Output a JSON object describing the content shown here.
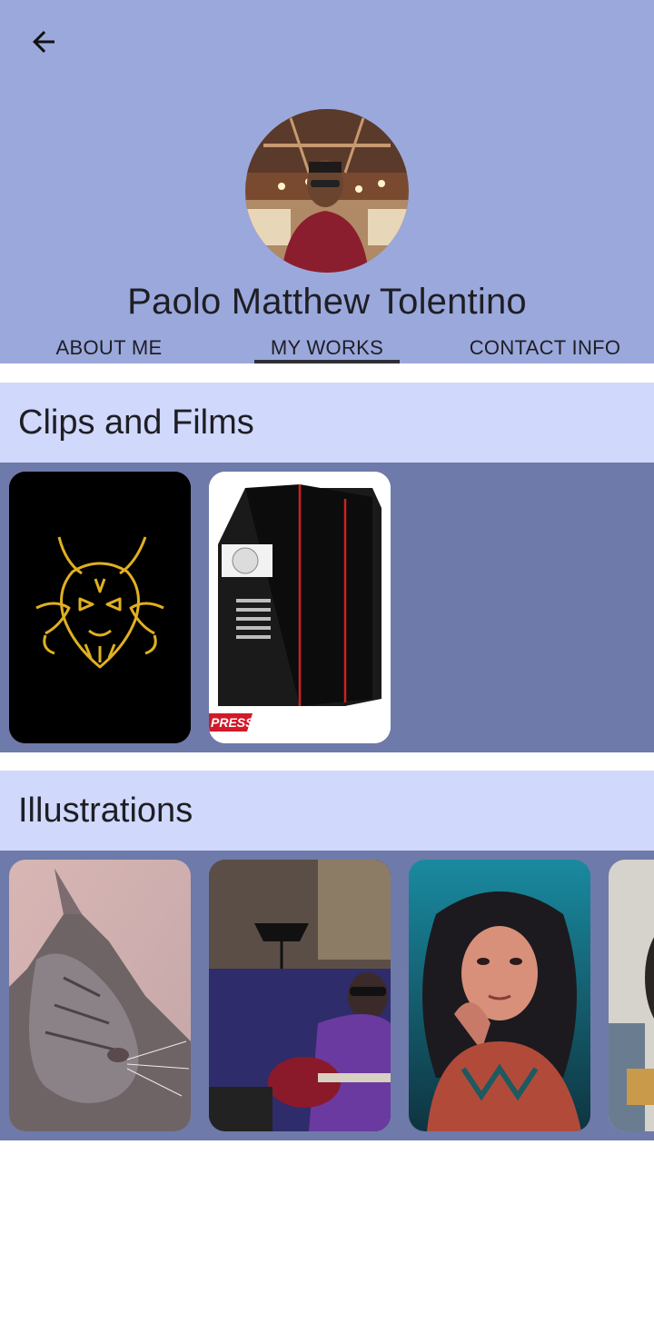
{
  "profile": {
    "name": "Paolo Matthew Tolentino"
  },
  "tabs": [
    {
      "label": "ABOUT ME",
      "active": false
    },
    {
      "label": "MY WORKS",
      "active": true
    },
    {
      "label": "CONTACT INFO",
      "active": false
    }
  ],
  "sections": {
    "clips": {
      "title": "Clips and Films",
      "items": [
        {
          "thumbnail": "golden-dragon-logo"
        },
        {
          "thumbnail": "pc-case-product",
          "badge": "PRESS"
        }
      ]
    },
    "illustrations": {
      "title": "Illustrations",
      "items": [
        {
          "thumbnail": "cat-photo"
        },
        {
          "thumbnail": "guitarist-photo"
        },
        {
          "thumbnail": "woman-portrait-photo"
        },
        {
          "thumbnail": "partial-portrait-photo"
        }
      ]
    }
  },
  "colors": {
    "header_bg": "#9ba8dc",
    "section_title_bg": "#d0d8fc",
    "strip_bg": "#6e7aa9"
  },
  "icons": {
    "back": "arrow-left-icon"
  }
}
